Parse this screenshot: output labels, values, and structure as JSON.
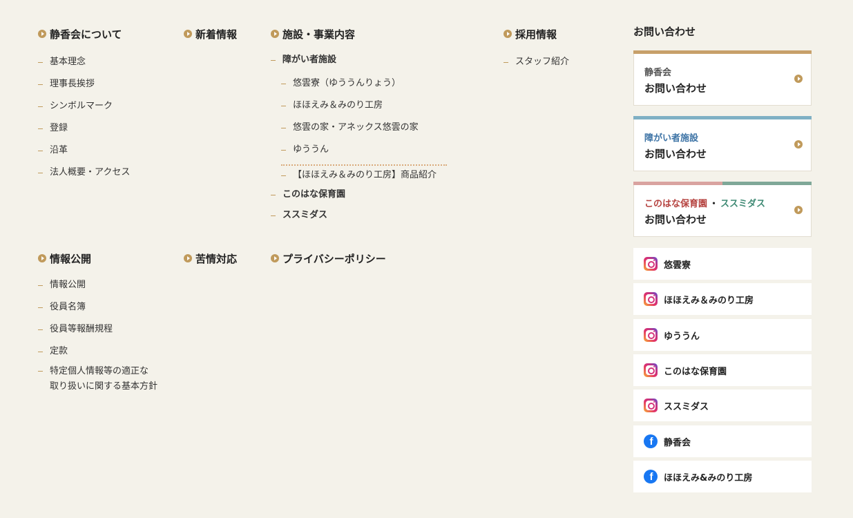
{
  "about": {
    "title": "静香会について",
    "items": [
      "基本理念",
      "理事長挨拶",
      "シンボルマーク",
      "登録",
      "沿革",
      "法人概要・アクセス"
    ]
  },
  "news": {
    "title": "新着情報"
  },
  "facilities": {
    "title": "施設・事業内容",
    "disability": {
      "label": "障がい者施設",
      "items": [
        "悠雲寮（ゆううんりょう）",
        "ほほえみ＆みのり工房",
        "悠雲の家・アネックス悠雲の家",
        "ゆううん"
      ],
      "product": "【ほほえみ＆みのり工房】商品紹介"
    },
    "nursery": "このはな保育園",
    "susumidasu": "ススミダス"
  },
  "recruit": {
    "title": "採用情報",
    "items": [
      "スタッフ紹介"
    ]
  },
  "disclosure": {
    "title": "情報公開",
    "items": [
      "情報公開",
      "役員名簿",
      "役員等報酬規程",
      "定款"
    ],
    "policy_line1": "特定個人情報等の適正な",
    "policy_line2": "取り扱いに関する基本方針"
  },
  "complaint": {
    "title": "苦情対応"
  },
  "privacy": {
    "title": "プライバシーポリシー"
  },
  "contact": {
    "title": "お問い合わせ",
    "cards": [
      {
        "small": "静香会",
        "big": "お問い合わせ",
        "color": "#c7a06a"
      },
      {
        "small": "障がい者施設",
        "big": "お問い合わせ",
        "color": "#7fb0c4"
      },
      {
        "small_a": "このはな保育園",
        "sep": "・",
        "small_b": "ススミダス",
        "big": "お問い合わせ",
        "color_a": "#d9a3a0",
        "color_b": "#7fa898"
      }
    ]
  },
  "social": [
    {
      "type": "instagram",
      "label": "悠雲寮"
    },
    {
      "type": "instagram",
      "label": "ほほえみ＆みのり工房"
    },
    {
      "type": "instagram",
      "label": "ゆううん"
    },
    {
      "type": "instagram",
      "label": "このはな保育園"
    },
    {
      "type": "instagram",
      "label": "ススミダス"
    },
    {
      "type": "facebook",
      "label": "静香会"
    },
    {
      "type": "facebook",
      "label": "ほほえみ&みのり工房"
    }
  ],
  "colors": {
    "accent": "#c09a5b",
    "background": "#f4f2ea",
    "disability_text": "#3e74a6",
    "nursery_text": "#b5423f",
    "susumidasu_text": "#3f8a74"
  },
  "icons": {
    "arrow": "circle-arrow-icon",
    "instagram": "instagram-icon",
    "facebook": "facebook-icon"
  }
}
